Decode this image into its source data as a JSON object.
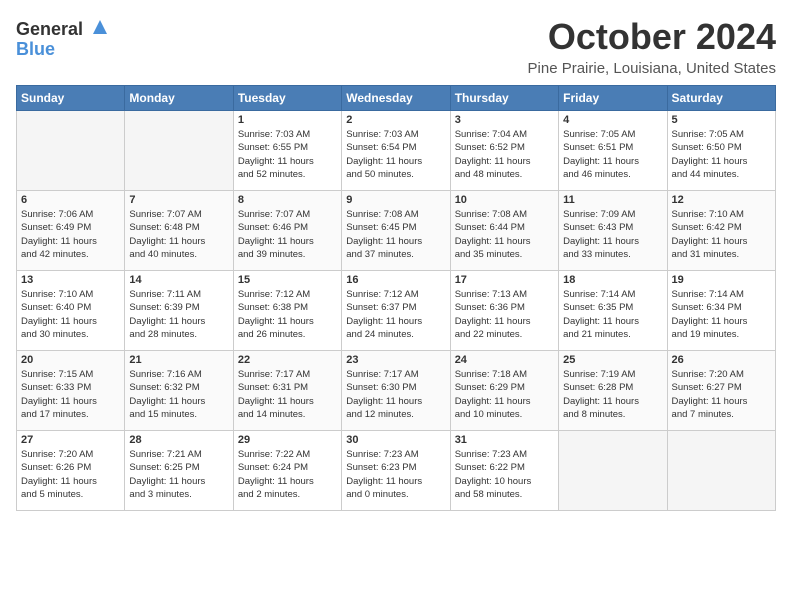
{
  "logo": {
    "line1": "General",
    "line2": "Blue"
  },
  "title": "October 2024",
  "location": "Pine Prairie, Louisiana, United States",
  "weekdays": [
    "Sunday",
    "Monday",
    "Tuesday",
    "Wednesday",
    "Thursday",
    "Friday",
    "Saturday"
  ],
  "weeks": [
    [
      {
        "day": "",
        "content": ""
      },
      {
        "day": "",
        "content": ""
      },
      {
        "day": "1",
        "content": "Sunrise: 7:03 AM\nSunset: 6:55 PM\nDaylight: 11 hours\nand 52 minutes."
      },
      {
        "day": "2",
        "content": "Sunrise: 7:03 AM\nSunset: 6:54 PM\nDaylight: 11 hours\nand 50 minutes."
      },
      {
        "day": "3",
        "content": "Sunrise: 7:04 AM\nSunset: 6:52 PM\nDaylight: 11 hours\nand 48 minutes."
      },
      {
        "day": "4",
        "content": "Sunrise: 7:05 AM\nSunset: 6:51 PM\nDaylight: 11 hours\nand 46 minutes."
      },
      {
        "day": "5",
        "content": "Sunrise: 7:05 AM\nSunset: 6:50 PM\nDaylight: 11 hours\nand 44 minutes."
      }
    ],
    [
      {
        "day": "6",
        "content": "Sunrise: 7:06 AM\nSunset: 6:49 PM\nDaylight: 11 hours\nand 42 minutes."
      },
      {
        "day": "7",
        "content": "Sunrise: 7:07 AM\nSunset: 6:48 PM\nDaylight: 11 hours\nand 40 minutes."
      },
      {
        "day": "8",
        "content": "Sunrise: 7:07 AM\nSunset: 6:46 PM\nDaylight: 11 hours\nand 39 minutes."
      },
      {
        "day": "9",
        "content": "Sunrise: 7:08 AM\nSunset: 6:45 PM\nDaylight: 11 hours\nand 37 minutes."
      },
      {
        "day": "10",
        "content": "Sunrise: 7:08 AM\nSunset: 6:44 PM\nDaylight: 11 hours\nand 35 minutes."
      },
      {
        "day": "11",
        "content": "Sunrise: 7:09 AM\nSunset: 6:43 PM\nDaylight: 11 hours\nand 33 minutes."
      },
      {
        "day": "12",
        "content": "Sunrise: 7:10 AM\nSunset: 6:42 PM\nDaylight: 11 hours\nand 31 minutes."
      }
    ],
    [
      {
        "day": "13",
        "content": "Sunrise: 7:10 AM\nSunset: 6:40 PM\nDaylight: 11 hours\nand 30 minutes."
      },
      {
        "day": "14",
        "content": "Sunrise: 7:11 AM\nSunset: 6:39 PM\nDaylight: 11 hours\nand 28 minutes."
      },
      {
        "day": "15",
        "content": "Sunrise: 7:12 AM\nSunset: 6:38 PM\nDaylight: 11 hours\nand 26 minutes."
      },
      {
        "day": "16",
        "content": "Sunrise: 7:12 AM\nSunset: 6:37 PM\nDaylight: 11 hours\nand 24 minutes."
      },
      {
        "day": "17",
        "content": "Sunrise: 7:13 AM\nSunset: 6:36 PM\nDaylight: 11 hours\nand 22 minutes."
      },
      {
        "day": "18",
        "content": "Sunrise: 7:14 AM\nSunset: 6:35 PM\nDaylight: 11 hours\nand 21 minutes."
      },
      {
        "day": "19",
        "content": "Sunrise: 7:14 AM\nSunset: 6:34 PM\nDaylight: 11 hours\nand 19 minutes."
      }
    ],
    [
      {
        "day": "20",
        "content": "Sunrise: 7:15 AM\nSunset: 6:33 PM\nDaylight: 11 hours\nand 17 minutes."
      },
      {
        "day": "21",
        "content": "Sunrise: 7:16 AM\nSunset: 6:32 PM\nDaylight: 11 hours\nand 15 minutes."
      },
      {
        "day": "22",
        "content": "Sunrise: 7:17 AM\nSunset: 6:31 PM\nDaylight: 11 hours\nand 14 minutes."
      },
      {
        "day": "23",
        "content": "Sunrise: 7:17 AM\nSunset: 6:30 PM\nDaylight: 11 hours\nand 12 minutes."
      },
      {
        "day": "24",
        "content": "Sunrise: 7:18 AM\nSunset: 6:29 PM\nDaylight: 11 hours\nand 10 minutes."
      },
      {
        "day": "25",
        "content": "Sunrise: 7:19 AM\nSunset: 6:28 PM\nDaylight: 11 hours\nand 8 minutes."
      },
      {
        "day": "26",
        "content": "Sunrise: 7:20 AM\nSunset: 6:27 PM\nDaylight: 11 hours\nand 7 minutes."
      }
    ],
    [
      {
        "day": "27",
        "content": "Sunrise: 7:20 AM\nSunset: 6:26 PM\nDaylight: 11 hours\nand 5 minutes."
      },
      {
        "day": "28",
        "content": "Sunrise: 7:21 AM\nSunset: 6:25 PM\nDaylight: 11 hours\nand 3 minutes."
      },
      {
        "day": "29",
        "content": "Sunrise: 7:22 AM\nSunset: 6:24 PM\nDaylight: 11 hours\nand 2 minutes."
      },
      {
        "day": "30",
        "content": "Sunrise: 7:23 AM\nSunset: 6:23 PM\nDaylight: 11 hours\nand 0 minutes."
      },
      {
        "day": "31",
        "content": "Sunrise: 7:23 AM\nSunset: 6:22 PM\nDaylight: 10 hours\nand 58 minutes."
      },
      {
        "day": "",
        "content": ""
      },
      {
        "day": "",
        "content": ""
      }
    ]
  ]
}
